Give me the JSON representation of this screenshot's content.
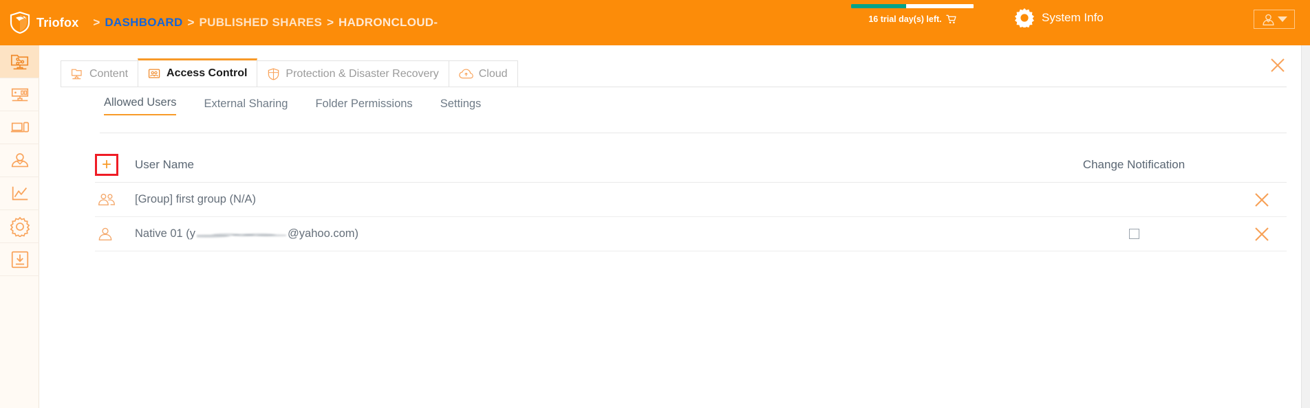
{
  "header": {
    "brand": "Triofox",
    "logo_icon": "shield-logo-icon",
    "breadcrumb": [
      {
        "label": "DASHBOARD",
        "kind": "link"
      },
      {
        "label": "PUBLISHED SHARES",
        "kind": "link-muted"
      },
      {
        "label": "HADRONCLOUD-",
        "kind": "current"
      }
    ],
    "separator": ">",
    "trial": {
      "text": "16 trial day(s) left.",
      "cart_icon": "shopping-cart-icon",
      "progress_percent": 45,
      "fill_color": "#00a389",
      "track_color": "#ffffff"
    },
    "system_info": {
      "label": "System Info",
      "icon": "gear-icon"
    },
    "user_menu": {
      "icon": "user-icon",
      "caret_icon": "chevron-down-icon"
    },
    "background_color": "#fc8c09",
    "link_color": "#1565d8"
  },
  "sidebar": {
    "items": [
      {
        "name": "shared-folder",
        "icon": "shared-folder-icon",
        "active": true
      },
      {
        "name": "server",
        "icon": "server-icon",
        "active": false
      },
      {
        "name": "devices",
        "icon": "devices-icon",
        "active": false
      },
      {
        "name": "users",
        "icon": "user-profile-icon",
        "active": false
      },
      {
        "name": "reports",
        "icon": "chart-line-icon",
        "active": false
      },
      {
        "name": "settings",
        "icon": "gear-icon",
        "active": false
      },
      {
        "name": "downloads",
        "icon": "download-box-icon",
        "active": false
      }
    ]
  },
  "main": {
    "tabs": [
      {
        "label": "Content",
        "icon": "content-folder-icon",
        "active": false
      },
      {
        "label": "Access Control",
        "icon": "access-control-icon",
        "active": true
      },
      {
        "label": "Protection & Disaster Recovery",
        "icon": "shield-icon",
        "active": false
      },
      {
        "label": "Cloud",
        "icon": "cloud-icon",
        "active": false
      }
    ],
    "close_icon": "close-icon",
    "subnav": [
      {
        "label": "Allowed Users",
        "active": true
      },
      {
        "label": "External Sharing",
        "active": false
      },
      {
        "label": "Folder Permissions",
        "active": false
      },
      {
        "label": "Settings",
        "active": false
      }
    ],
    "table": {
      "add_button": {
        "label": "+",
        "icon": "plus-icon",
        "highlight_color": "#ef1c25"
      },
      "columns": {
        "user_name": "User Name",
        "change_notification": "Change Notification"
      },
      "rows": [
        {
          "icon": "group-icon",
          "name_prefix": "[Group] first group (N/A)",
          "name_suffix": "",
          "redacted": false,
          "has_checkbox": false,
          "checked": false,
          "remove_icon": "close-icon"
        },
        {
          "icon": "user-icon",
          "name_prefix": "Native 01 (y",
          "name_suffix": "@yahoo.com)",
          "redacted": true,
          "has_checkbox": true,
          "checked": false,
          "remove_icon": "close-icon"
        }
      ]
    }
  },
  "accents": {
    "orange": "#f89a28",
    "orange_dark": "#fc8c09",
    "icon_orange": "#f9a45c",
    "text_gray": "#5a6673"
  }
}
